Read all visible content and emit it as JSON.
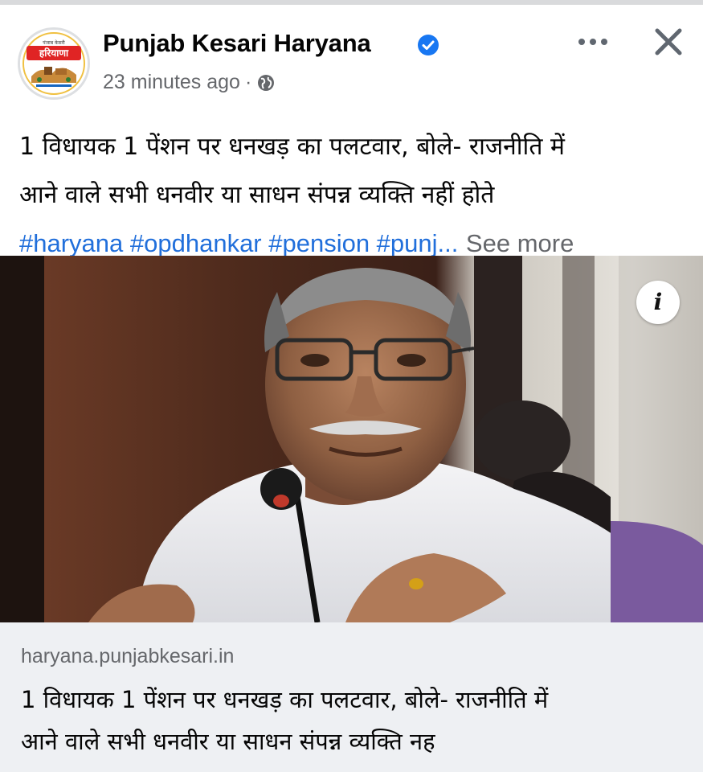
{
  "post": {
    "page_name": "Punjab Kesari Haryana",
    "time": "23 minutes ago",
    "separator": "·",
    "caption_line1": "1 विधायक 1 पेंशन पर धनखड़ का पलटवार, बोले- राजनीति में",
    "caption_line2": "आने वाले सभी धनवीर या साधन संपन्न व्यक्ति नहीं होते",
    "hashtags": "#haryana #opdhankar #pension #punj...",
    "see_more": "See more"
  },
  "avatar_logo": {
    "main_text": "हरियाणा",
    "small_text": "पंजाब केसरी"
  },
  "link_preview": {
    "domain": "haryana.punjabkesari.in",
    "title_line1": "1 विधायक 1 पेंशन पर धनखड़ का पलटवार, बोले- राजनीति में",
    "title_line2": "आने वाले सभी धनवीर या साधन संपन्न व्यक्ति नह"
  },
  "icons": {
    "verified": "verified-badge-icon",
    "globe": "globe-icon",
    "more": "more-options-icon",
    "close": "close-icon",
    "info": "info-icon"
  },
  "colors": {
    "link_blue": "#216fdb",
    "verified_blue": "#1877f2",
    "secondary_text": "#65676b",
    "card_bg": "#eef0f3"
  }
}
